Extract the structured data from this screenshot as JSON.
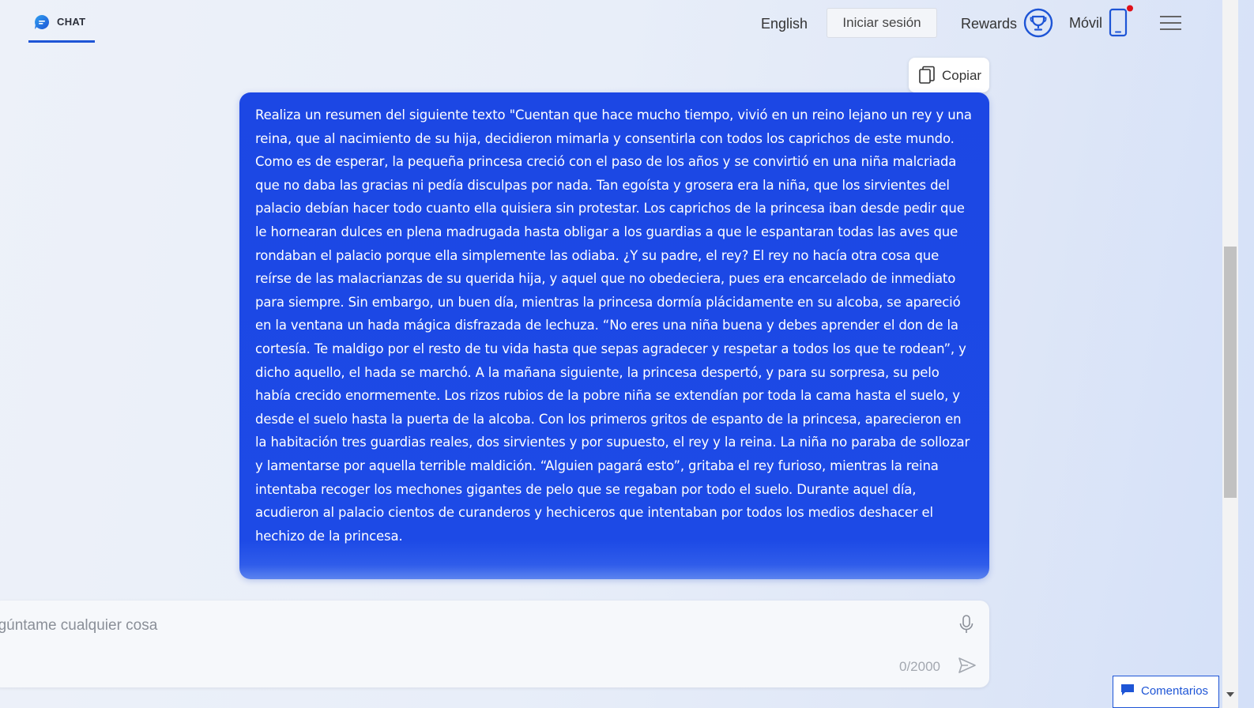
{
  "header": {
    "chat_tab_label": "CHAT",
    "language_link": "English",
    "login_button": "Iniciar sesión",
    "rewards_label": "Rewards",
    "mobile_label": "Móvil"
  },
  "message": {
    "copy_label": "Copiar",
    "text": "Realiza un resumen del siguiente texto \"Cuentan que hace mucho tiempo, vivió en un reino lejano un rey y una reina, que al nacimiento de su hija, decidieron mimarla y consentirla con todos los caprichos de este mundo. Como es de esperar, la pequeña princesa creció con el paso de los años y se convirtió en una niña malcriada que no daba las gracias ni pedía disculpas por nada. Tan egoísta y grosera era la niña, que los sirvientes del palacio debían hacer todo cuanto ella quisiera sin protestar. Los caprichos de la princesa iban desde pedir que le hornearan dulces en plena madrugada hasta obligar a los guardias a que le espantaran todas las aves que rondaban el palacio porque ella simplemente las odiaba. ¿Y su padre, el rey? El rey no hacía otra cosa que reírse de las malacrianzas de su querida hija, y aquel que no obedeciera, pues era encarcelado de inmediato para siempre. Sin embargo, un buen día, mientras la princesa dormía plácidamente en su alcoba, se apareció en la ventana un hada mágica disfrazada de lechuza. “No eres una niña buena y debes aprender el don de la cortesía. Te maldigo por el resto de tu vida hasta que sepas agradecer y respetar a todos los que te rodean”, y dicho aquello, el hada se marchó. A la mañana siguiente, la princesa despertó, y para su sorpresa, su pelo había crecido enormemente. Los rizos rubios de la pobre niña se extendían por toda la cama hasta el suelo, y desde el suelo hasta la puerta de la alcoba. Con los primeros gritos de espanto de la princesa, aparecieron en la habitación tres guardias reales, dos sirvientes y por supuesto, el rey y la reina. La niña no paraba de sollozar y lamentarse por aquella terrible maldición. “Alguien pagará esto”, gritaba el rey furioso, mientras la reina intentaba recoger los mechones gigantes de pelo que se regaban por todo el suelo. Durante aquel día, acudieron al palacio cientos de curanderos y hechiceros que intentaban por todos los medios deshacer el hechizo de la princesa."
  },
  "composer": {
    "placeholder": "Pregúntame cualquier cosa",
    "value": "",
    "char_count": "0/2000"
  },
  "feedback": {
    "label": "Comentarios"
  },
  "icons": {
    "chat_logo": "chat-bubble-icon",
    "rewards": "trophy-icon",
    "mobile": "phone-icon",
    "menu": "hamburger-menu-icon",
    "copy": "copy-icon",
    "mic": "microphone-icon",
    "send": "send-icon",
    "feedback": "comment-icon"
  },
  "colors": {
    "accent": "#1e55d6",
    "bubble": "#1c47e4",
    "notification_dot": "#e0101a"
  },
  "scroll": {
    "position_fraction": 0.35
  }
}
